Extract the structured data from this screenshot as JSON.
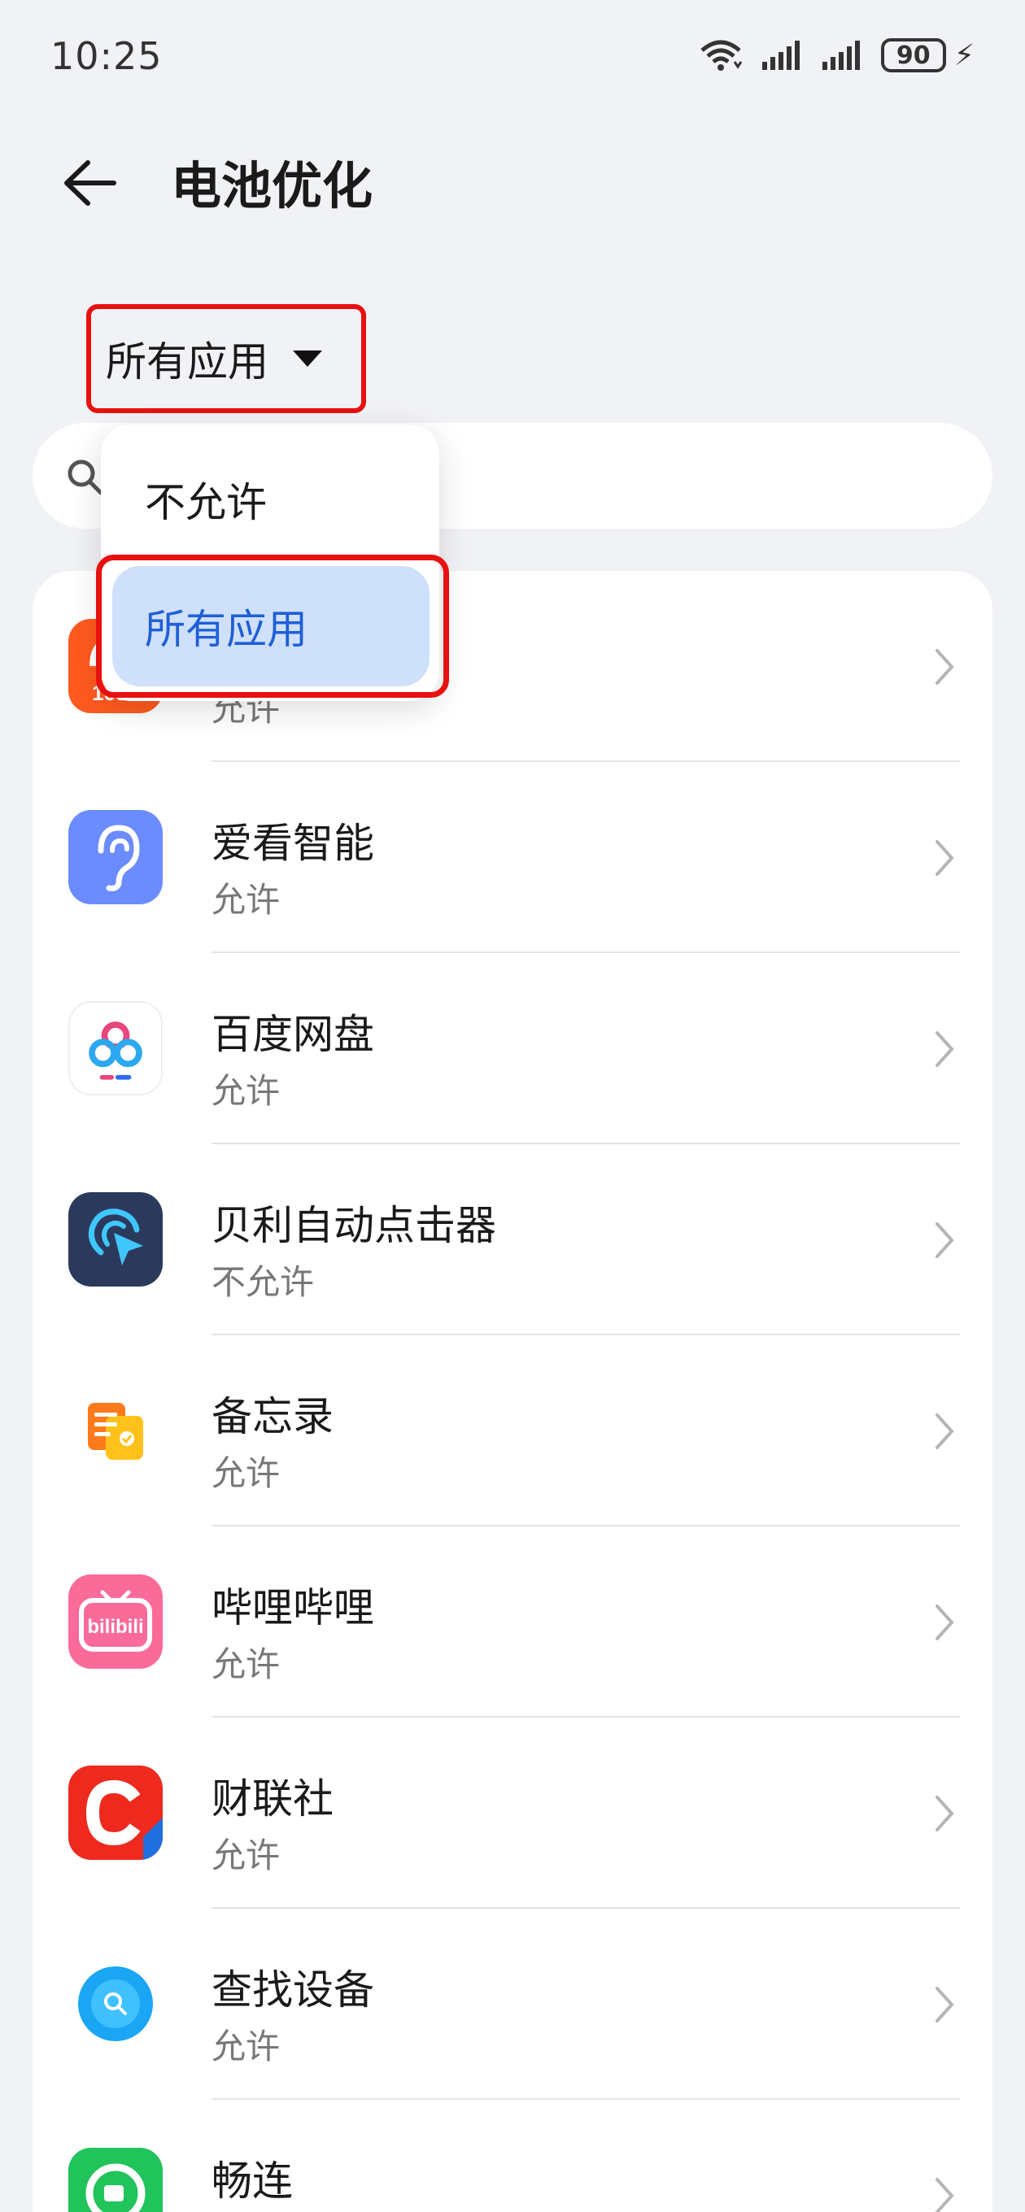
{
  "status_bar": {
    "time": "10:25",
    "battery": "90"
  },
  "header": {
    "title": "电池优化"
  },
  "filter": {
    "label": "所有应用"
  },
  "dropdown": {
    "options": [
      {
        "label": "不允许",
        "selected": false
      },
      {
        "label": "所有应用",
        "selected": true
      }
    ]
  },
  "apps": [
    {
      "name": "",
      "status": "允许",
      "icon": "icon-1688",
      "color": "#ff5a1f"
    },
    {
      "name": "爱看智能",
      "status": "允许",
      "icon": "ear-icon",
      "color": "#6b8cff"
    },
    {
      "name": "百度网盘",
      "status": "允许",
      "icon": "baidu-netdisk-icon",
      "color": "#ffffff"
    },
    {
      "name": "贝利自动点击器",
      "status": "不允许",
      "icon": "auto-clicker-icon",
      "color": "#2b3a5c"
    },
    {
      "name": "备忘录",
      "status": "允许",
      "icon": "memo-icon",
      "color": "#ffffff"
    },
    {
      "name": "哔哩哔哩",
      "status": "允许",
      "icon": "bilibili-icon",
      "color": "#fb6b99"
    },
    {
      "name": "财联社",
      "status": "允许",
      "icon": "cls-icon",
      "color": "#ee2a1e"
    },
    {
      "name": "查找设备",
      "status": "允许",
      "icon": "find-device-icon",
      "color": "#1aa6f5"
    },
    {
      "name": "畅连",
      "status": "",
      "icon": "changlian-icon",
      "color": "#21c35b"
    }
  ]
}
